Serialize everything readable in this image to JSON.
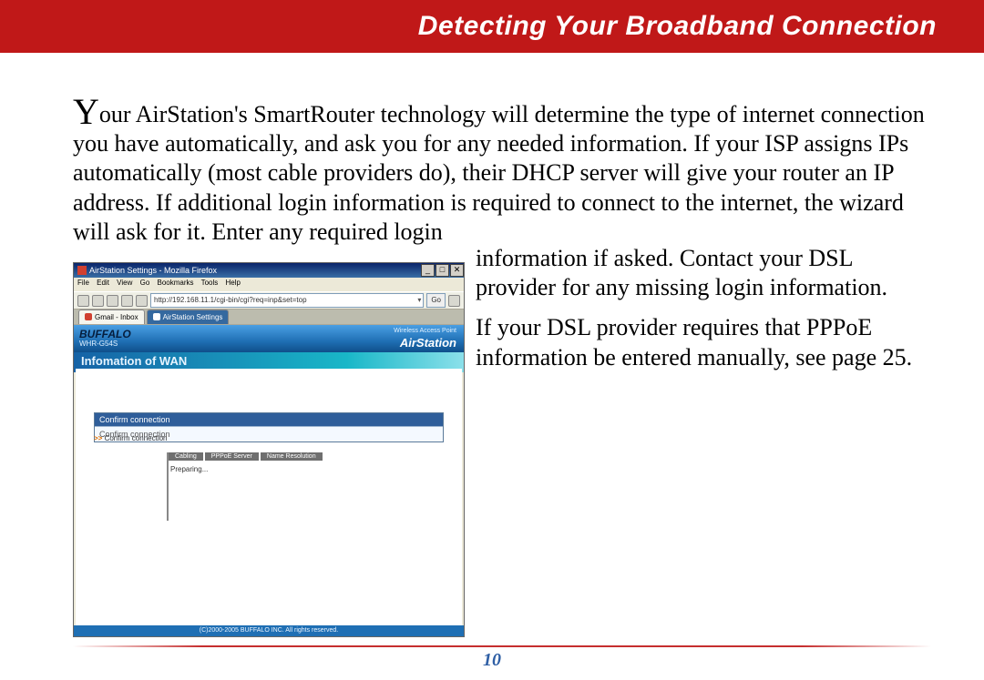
{
  "banner": {
    "title": "Detecting Your Broadband Connection"
  },
  "body": {
    "dropcap": "Y",
    "p1_top": "our AirStation's SmartRouter technology will determine the type of internet connection you have automatically, and ask you for any needed information.  If your ISP assigns IPs automatically (most cable providers do), their DHCP server will give your router an IP address.  If additional login information is required to connect to the internet, the wizard will ask for it.  Enter any required login",
    "p1_wrap": "information if asked.  Contact your DSL provider for any missing login information.",
    "p2": "If your DSL provider requires that PPPoE information be entered manually, see page 25."
  },
  "screenshot": {
    "window_title": "AirStation Settings - Mozilla Firefox",
    "min": "_",
    "max": "□",
    "close": "✕",
    "menu": {
      "file": "File",
      "edit": "Edit",
      "view": "View",
      "go": "Go",
      "bookmarks": "Bookmarks",
      "tools": "Tools",
      "help": "Help"
    },
    "address": "http://192.168.11.1/cgi-bin/cgi?req=inp&set=top",
    "go": "Go",
    "tabs": {
      "t1": "Gmail - Inbox",
      "t2": "AirStation Settings"
    },
    "air": {
      "brand": "BUFFALO",
      "model": "WHR-G54S",
      "wap": "Wireless Access Point",
      "name": "AirStation"
    },
    "subheader": "Infomation of WAN",
    "confirm_hdr": "Confirm connection",
    "confirm_row": "Confirm connection",
    "crumb_marker": ">>",
    "crumb": "Confirm connection",
    "cols": {
      "c1": "Cabling",
      "c2": "PPPoE Server",
      "c3": "Name Resolution"
    },
    "preparing": "Preparing...",
    "footer": "(C)2000-2005 BUFFALO INC. All rights reserved."
  },
  "page_number": "10"
}
